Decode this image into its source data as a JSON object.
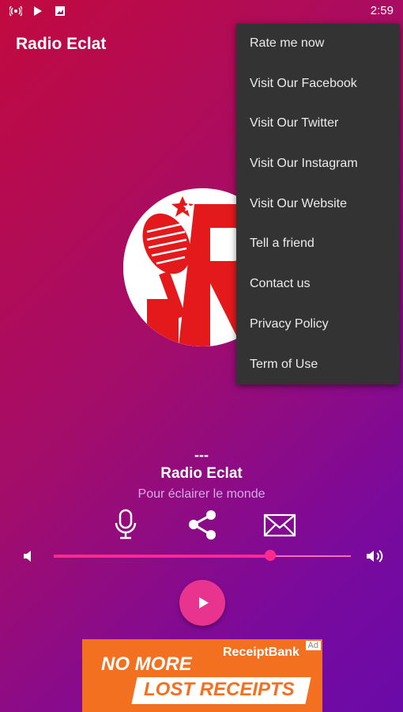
{
  "status_bar": {
    "time": "2:59",
    "icons": [
      "radio-signal-icon",
      "play-store-icon",
      "image-icon"
    ]
  },
  "app_bar": {
    "title": "Radio Eclat"
  },
  "menu": {
    "items": [
      "Rate me now",
      "Visit Our Facebook",
      "Visit Our Twitter",
      "Visit Our Instagram",
      "Visit Our Website",
      "Tell a friend",
      "Contact us",
      "Privacy Policy",
      "Term of Use"
    ]
  },
  "player": {
    "track": "---",
    "station": "Radio Eclat",
    "slogan": "Pour éclairer le monde",
    "volume_percent": 73,
    "actions": [
      "microphone-icon",
      "share-icon",
      "mail-icon"
    ]
  },
  "ad": {
    "line1": "NO MORE",
    "line2": "LOST RECEIPTS",
    "brand": "ReceiptBank",
    "badge": "Ad"
  },
  "colors": {
    "accent": "#e8348e",
    "menu_bg": "#333333",
    "ad_bg": "#f37021"
  }
}
